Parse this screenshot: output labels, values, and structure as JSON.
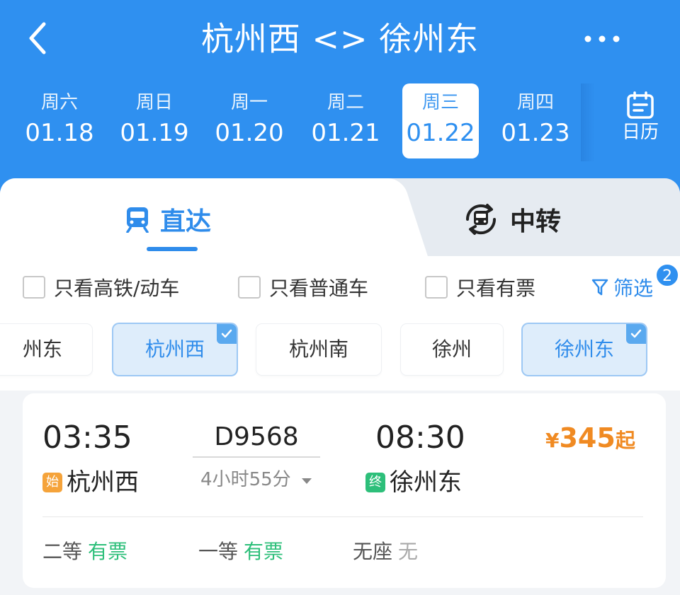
{
  "header": {
    "title": "杭州西 <> 徐州东",
    "icons": {
      "back": "back-arrow-icon",
      "more": "more-dots-icon"
    }
  },
  "dates": [
    {
      "weekday": "周六",
      "date": "01.18",
      "selected": false
    },
    {
      "weekday": "周日",
      "date": "01.19",
      "selected": false
    },
    {
      "weekday": "周一",
      "date": "01.20",
      "selected": false
    },
    {
      "weekday": "周二",
      "date": "01.21",
      "selected": false
    },
    {
      "weekday": "周三",
      "date": "01.22",
      "selected": true
    },
    {
      "weekday": "周四",
      "date": "01.23",
      "selected": false
    }
  ],
  "calendar": {
    "label": "日历",
    "icon": "calendar-icon"
  },
  "tabs": {
    "direct": {
      "label": "直达",
      "icon": "train-icon",
      "active": true
    },
    "transfer": {
      "label": "中转",
      "icon": "transfer-train-icon",
      "active": false
    }
  },
  "filters": {
    "high_speed_only": {
      "label": "只看高铁/动车",
      "checked": false
    },
    "regular_only": {
      "label": "只看普通车",
      "checked": false
    },
    "available_only": {
      "label": "只看有票",
      "checked": false
    },
    "filter_button": {
      "label": "筛选",
      "badge": "2",
      "icon": "funnel-icon"
    }
  },
  "stations": [
    {
      "name": "州东",
      "selected": false
    },
    {
      "name": "杭州西",
      "selected": true
    },
    {
      "name": "杭州南",
      "selected": false
    },
    {
      "name": "徐州",
      "selected": false
    },
    {
      "name": "徐州东",
      "selected": true
    }
  ],
  "train": {
    "departure_time": "03:35",
    "arrival_time": "08:30",
    "number": "D9568",
    "duration": "4小时55分",
    "departure_station": "杭州西",
    "departure_tag": "始",
    "arrival_station": "徐州东",
    "arrival_tag": "终",
    "price_currency": "¥",
    "price_value": "345",
    "price_suffix": "起",
    "seats": [
      {
        "class": "二等",
        "status": "有票",
        "available": true
      },
      {
        "class": "一等",
        "status": "有票",
        "available": true
      },
      {
        "class": "无座",
        "status": "无",
        "available": false
      }
    ]
  },
  "colors": {
    "brand_blue": "#2f90f0",
    "price_orange": "#f08a22",
    "available_green": "#2dbf7a",
    "start_tag": "#f5a33a"
  }
}
